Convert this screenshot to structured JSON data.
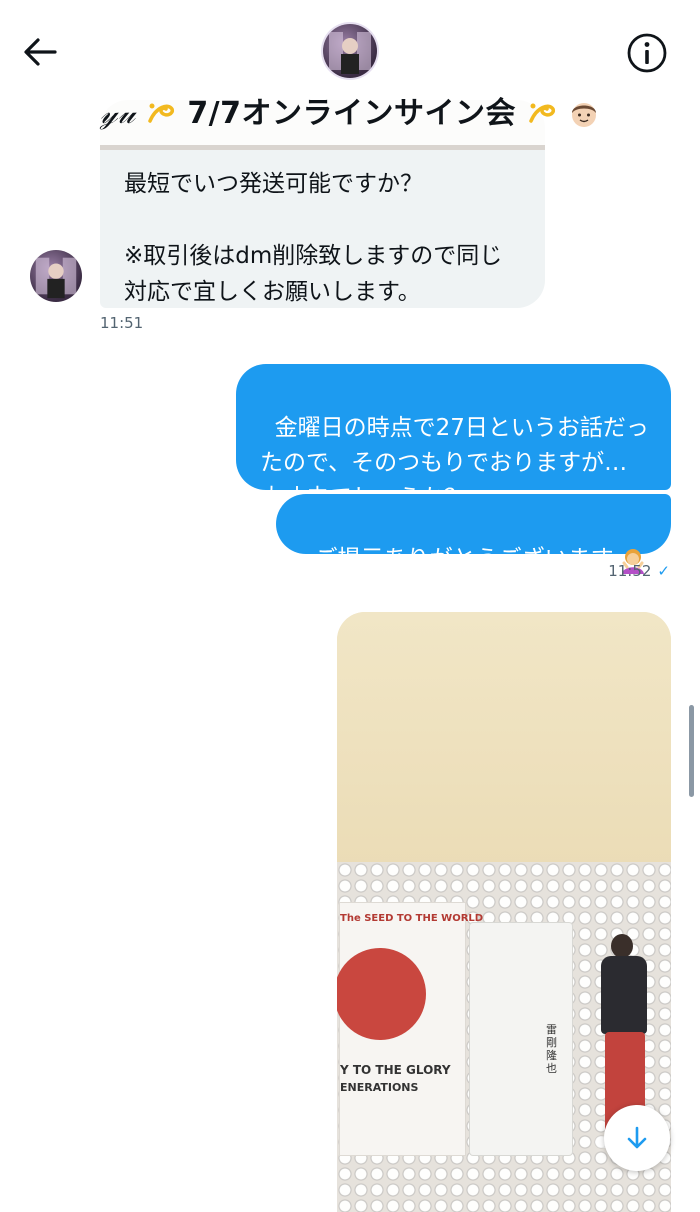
{
  "header": {
    "title_prefix": "𝓎𝓊",
    "title_main": "7/7オンラインサイン会",
    "back_icon": "arrow-left-icon",
    "info_icon": "info-icon"
  },
  "messages": {
    "incoming": {
      "text": "最短でいつ発送可能ですか？\n\n※取引後はdm削除致しますので同じ\n対応で宜しくお願いします。",
      "time": "11:51"
    },
    "outgoing_1": {
      "text": "金曜日の時点で27日というお話だっ\nたので、そのつもりでおりますが…\n大丈夫でしょうか？"
    },
    "outgoing_2": {
      "text": "ご提示ありがとうございます",
      "emoji": "bowing-person-emoji"
    },
    "outgoing_time": "11:52",
    "read_receipt": "✓",
    "photo": {
      "card1_top": "The SEED TO THE WORLD",
      "card1_mid": "Y TO THE GLORY",
      "card1_bottom": "ENERATIONS",
      "card2_vertical": "雷剛隆也"
    }
  },
  "colors": {
    "accent": "#1d9bf0",
    "incoming_bubble": "#eff3f4",
    "secondary_text": "#536471"
  }
}
